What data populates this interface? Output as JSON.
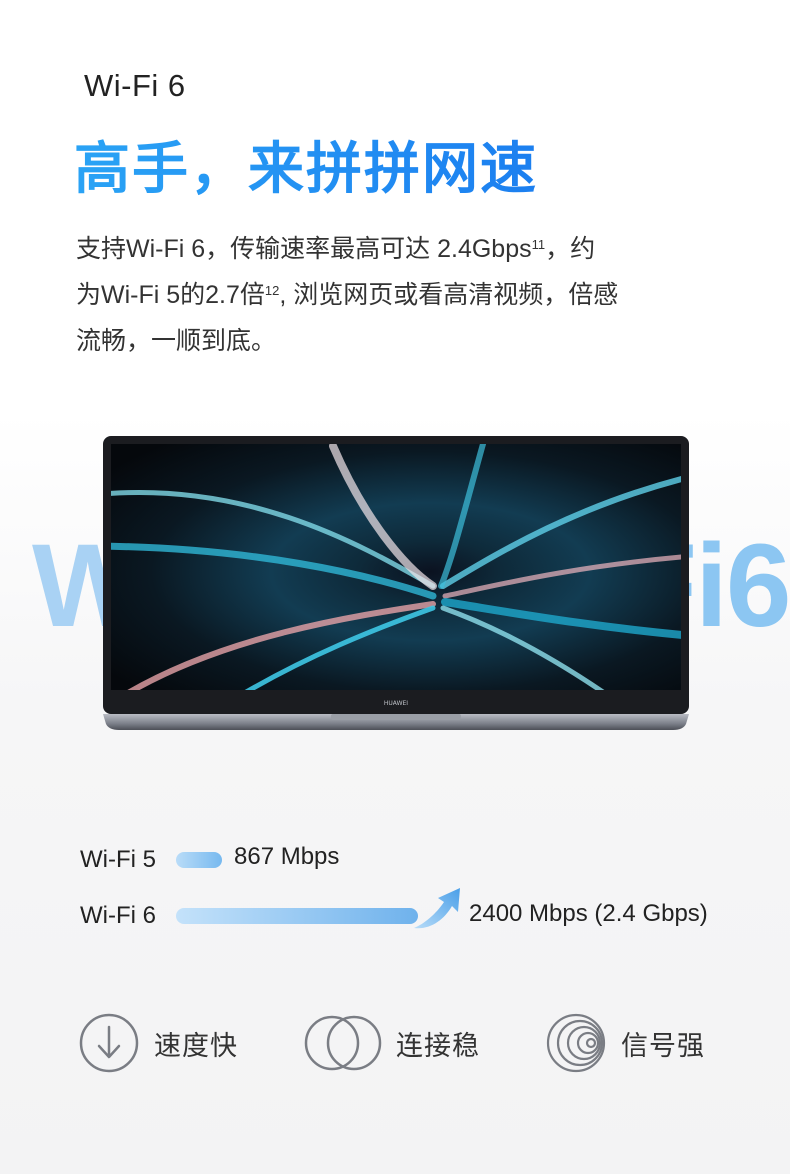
{
  "header": {
    "eyebrow": "Wi-Fi 6",
    "headline": "高手，来拼拼网速"
  },
  "description": {
    "line1": "支持Wi-Fi 6，传输速率最高可达 2.4Gbps",
    "line1_sup": "11",
    "line1_tail": "，约",
    "line2": "为Wi-Fi 5的2.7倍",
    "line2_sup": "12",
    "line2_tail": ", 浏览网页或看高清视频，倍感",
    "line3": "流畅，一顺到底。"
  },
  "background_text": {
    "left": "Wi",
    "right": "Fi6"
  },
  "laptop": {
    "brand": "HUAWEI"
  },
  "comparison": {
    "wifi5_label": "Wi-Fi 5",
    "wifi5_value": "867 Mbps",
    "wifi5_mbps": 867,
    "wifi6_label": "Wi-Fi 6",
    "wifi6_value": "2400 Mbps (2.4 Gbps)",
    "wifi6_mbps": 2400
  },
  "features": [
    {
      "icon": "download-arrow-icon",
      "label": "速度快"
    },
    {
      "icon": "overlapping-circles-icon",
      "label": "连接稳"
    },
    {
      "icon": "signal-rings-icon",
      "label": "信号强"
    }
  ],
  "colors": {
    "accent_blue": "#1c7ff0",
    "bar_blue": "#77b9ef",
    "big_text_blue": "#a9d2f4"
  }
}
